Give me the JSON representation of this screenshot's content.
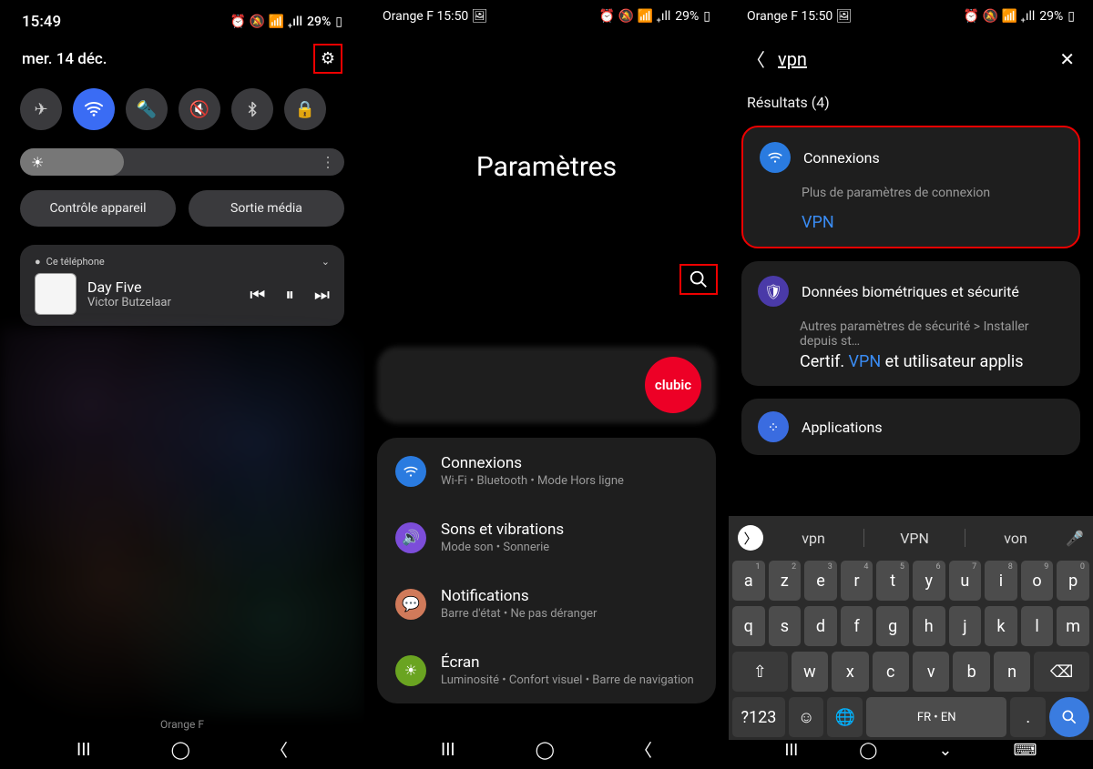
{
  "s1": {
    "time": "15:49",
    "battery": "29%",
    "date": "mer. 14 déc.",
    "buttons": {
      "control": "Contrôle appareil",
      "media": "Sortie média"
    },
    "player": {
      "device": "Ce téléphone",
      "title": "Day Five",
      "artist": "Victor Butzelaar"
    },
    "carrier": "Orange F"
  },
  "s2": {
    "carrier": "Orange F",
    "time": "15:50",
    "battery": "29%",
    "title": "Paramètres",
    "logo": "clubic",
    "items": [
      {
        "t": "Connexions",
        "s": "Wi-Fi  •  Bluetooth  •  Mode Hors ligne"
      },
      {
        "t": "Sons et vibrations",
        "s": "Mode son  •  Sonnerie"
      },
      {
        "t": "Notifications",
        "s": "Barre d'état  •  Ne pas déranger"
      },
      {
        "t": "Écran",
        "s": "Luminosité  •  Confort visuel  •  Barre de navigation"
      }
    ]
  },
  "s3": {
    "carrier": "Orange F",
    "time": "15:50",
    "battery": "29%",
    "query": "vpn",
    "results_h": "Résultats (4)",
    "r1": {
      "t": "Connexions",
      "s": "Plus de paramètres de connexion",
      "v": "VPN"
    },
    "r2": {
      "t": "Données biométriques et sécurité",
      "s": "Autres paramètres de sécurité > Installer depuis st…",
      "cert_a": "Certif. ",
      "cert_v": "VPN",
      "cert_b": " et utilisateur applis"
    },
    "r3": {
      "t": "Applications"
    },
    "suggest": [
      "vpn",
      "VPN",
      "von"
    ],
    "keys": {
      "row1": [
        "a",
        "z",
        "e",
        "r",
        "t",
        "y",
        "u",
        "i",
        "o",
        "p"
      ],
      "nums": [
        "1",
        "2",
        "3",
        "4",
        "5",
        "6",
        "7",
        "8",
        "9",
        "0"
      ],
      "row2": [
        "q",
        "s",
        "d",
        "f",
        "g",
        "h",
        "j",
        "k",
        "l",
        "m"
      ],
      "row3": [
        "w",
        "x",
        "c",
        "v",
        "b",
        "n"
      ],
      "sym": "?123",
      "space": "FR • EN"
    }
  }
}
